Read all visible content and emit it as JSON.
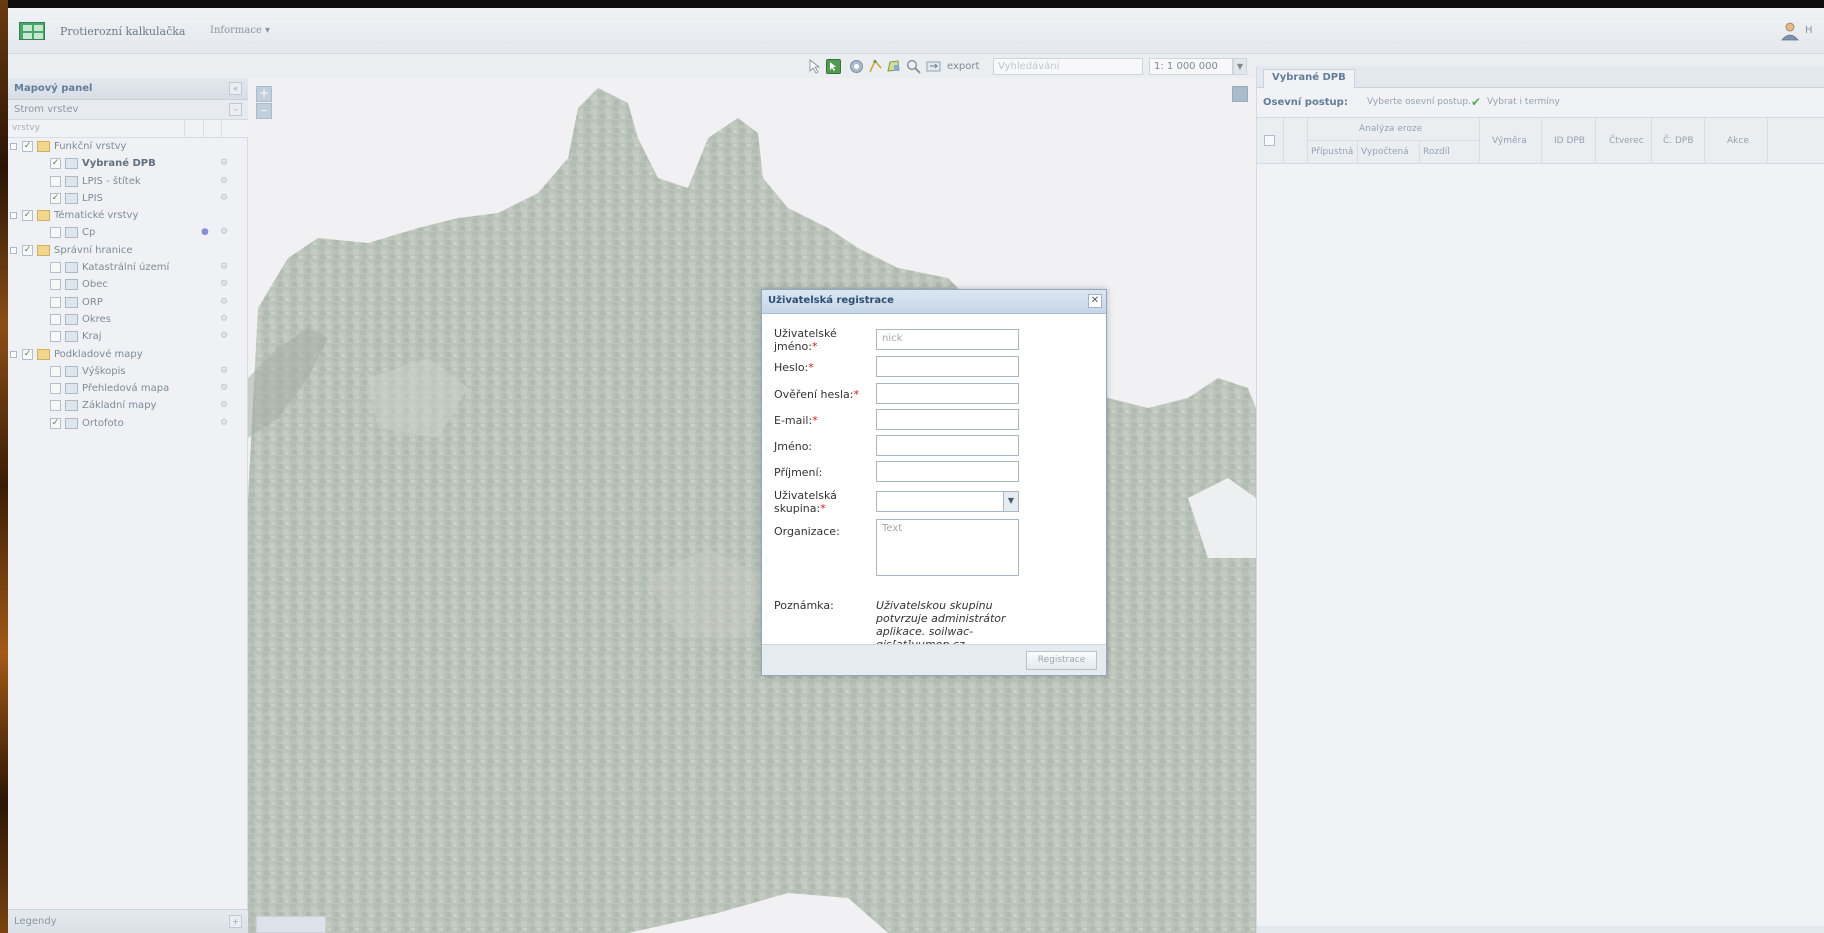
{
  "header": {
    "app_title": "Protierozní kalkulačka",
    "info_menu": "Informace ▾",
    "user_label": "H"
  },
  "toolbar": {
    "export_label": "export",
    "search_placeholder": "Vyhledávání",
    "scale_value": "1: 1 000 000"
  },
  "left_panel": {
    "title": "Mapový panel",
    "tree_header": "Strom vrstev",
    "column_header": "vrstvy",
    "legend": "Legendy",
    "items": [
      {
        "label": "Funkční vrstvy",
        "level": 0,
        "type": "folder",
        "checked": true
      },
      {
        "label": "Vybrané DPB",
        "level": 1,
        "type": "layer",
        "checked": true,
        "bold": true
      },
      {
        "label": "LPIS - štítek",
        "level": 1,
        "type": "layer",
        "checked": false
      },
      {
        "label": "LPIS",
        "level": 1,
        "type": "layer",
        "checked": true
      },
      {
        "label": "Tématické vrstvy",
        "level": 0,
        "type": "folder",
        "checked": true
      },
      {
        "label": "Cp",
        "level": 1,
        "type": "layer",
        "checked": false,
        "dot": true
      },
      {
        "label": "Správní hranice",
        "level": 0,
        "type": "folder",
        "checked": true
      },
      {
        "label": "Katastrální území",
        "level": 1,
        "type": "layer",
        "checked": false
      },
      {
        "label": "Obec",
        "level": 1,
        "type": "layer",
        "checked": false
      },
      {
        "label": "ORP",
        "level": 1,
        "type": "layer",
        "checked": false
      },
      {
        "label": "Okres",
        "level": 1,
        "type": "layer",
        "checked": false
      },
      {
        "label": "Kraj",
        "level": 1,
        "type": "layer",
        "checked": false
      },
      {
        "label": "Podkladové mapy",
        "level": 0,
        "type": "folder",
        "checked": true
      },
      {
        "label": "Výškopis",
        "level": 1,
        "type": "layer",
        "checked": false
      },
      {
        "label": "Přehledová mapa",
        "level": 1,
        "type": "layer",
        "checked": false
      },
      {
        "label": "Základní mapy",
        "level": 1,
        "type": "layer",
        "checked": false
      },
      {
        "label": "Ortofoto",
        "level": 1,
        "type": "layer",
        "checked": true
      }
    ]
  },
  "right_panel": {
    "tab": "Vybrané DPB",
    "procedure_label": "Osevní postup:",
    "procedure_select": "Vyberte osevní postup.",
    "terms_button": "Vybrat i termíny",
    "columns": {
      "group": "Analýza eroze",
      "allowed": "Přípustná",
      "computed": "Vypočtená",
      "difference": "Rozdíl",
      "area": "Výměra",
      "id_dpb": "ID DPB",
      "square": "Čtverec",
      "c_dpb": "Č. DPB",
      "action": "Akce"
    }
  },
  "dialog": {
    "title": "Uživatelská registrace",
    "fields": {
      "username_label_line1": "Uživatelské",
      "username_label_line2": "jméno:",
      "username_placeholder": "nick",
      "password_label": "Heslo:",
      "password_confirm_label": "Ověření hesla:",
      "email_label": "E-mail:",
      "first_name_label": "Jméno:",
      "last_name_label": "Příjmení:",
      "group_label_line1": "Uživatelská",
      "group_label_line2": "skupina:",
      "organization_label": "Organizace:",
      "organization_placeholder": "Text",
      "note_label": "Poznámka:",
      "note_text": "Uživatelskou skupinu potvrzuje administrátor aplikace. soilwac-gis[at]vumop.cz"
    },
    "required_mark": "*",
    "submit_button": "Registrace"
  }
}
